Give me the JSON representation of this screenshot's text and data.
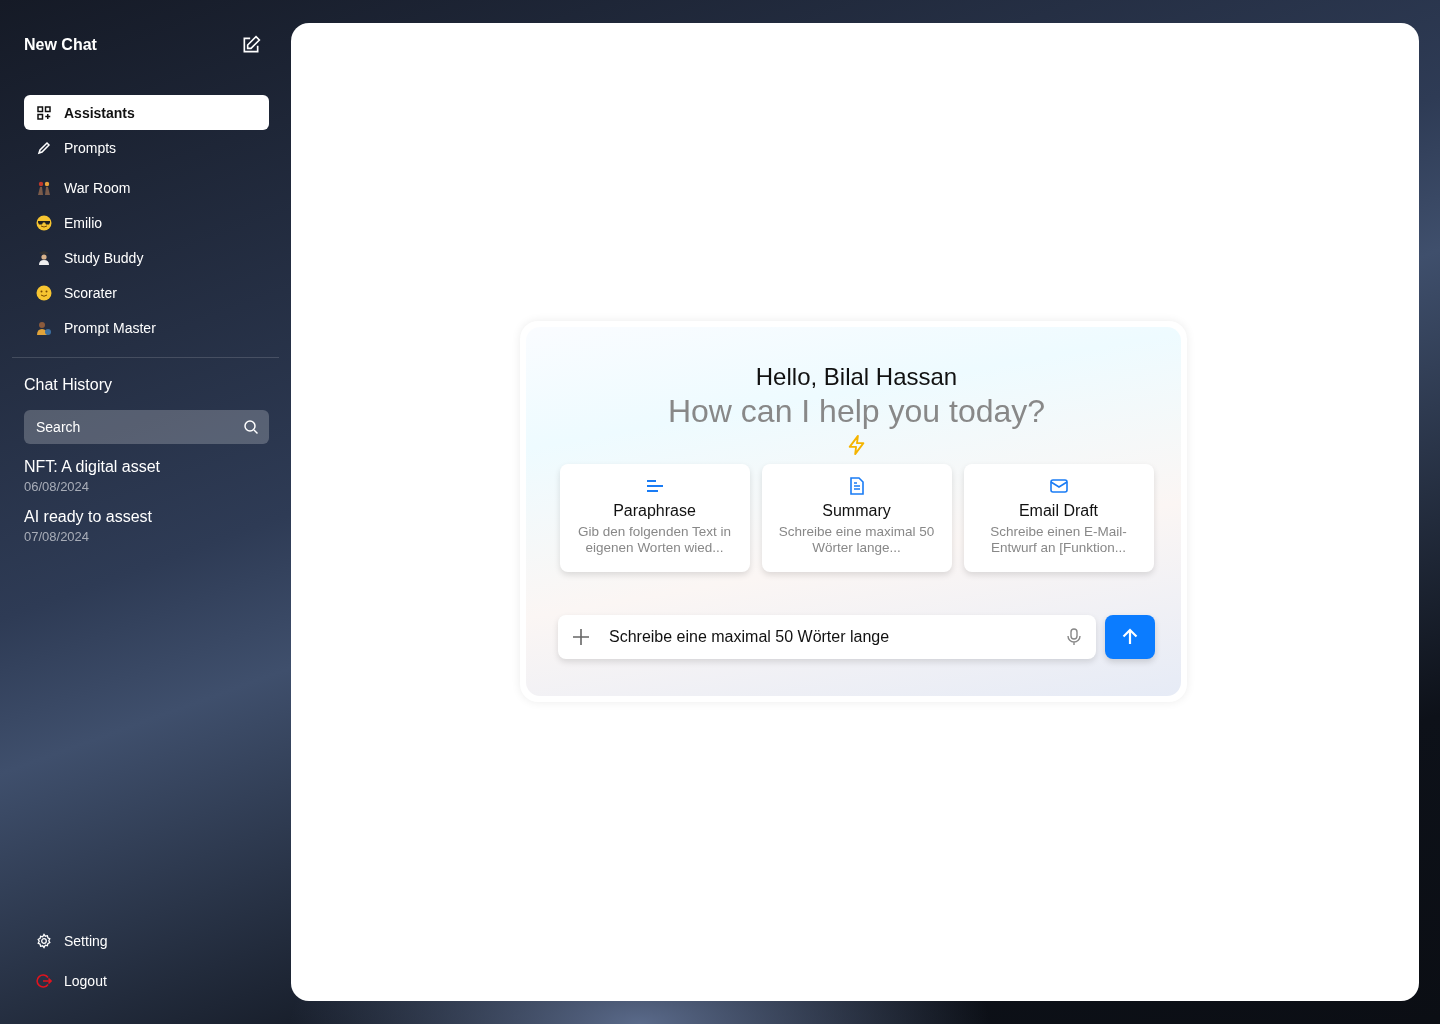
{
  "sidebar": {
    "new_chat": "New Chat",
    "nav": [
      {
        "label": "Assistants",
        "selected": true
      },
      {
        "label": "Prompts",
        "selected": false
      }
    ],
    "assistants": [
      {
        "name": "War Room"
      },
      {
        "name": "Emilio"
      },
      {
        "name": "Study Buddy"
      },
      {
        "name": "Scorater"
      },
      {
        "name": "Prompt Master"
      }
    ],
    "history_title": "Chat History",
    "search": {
      "placeholder": "Search"
    },
    "history": [
      {
        "title": "NFT: A digital asset",
        "date": "06/08/2024"
      },
      {
        "title": "AI ready to assest",
        "date": "07/08/2024"
      }
    ],
    "footer": [
      {
        "label": "Setting",
        "kind": "settings"
      },
      {
        "label": "Logout",
        "kind": "logout"
      }
    ]
  },
  "main": {
    "greeting": "Hello, Bilal Hassan",
    "question": "How can I help you today?",
    "suggestions": [
      {
        "title": "Paraphrase",
        "text": "Gib den folgenden Text in eigenen Worten wied...",
        "kind": "lines"
      },
      {
        "title": "Summary",
        "text": "Schreibe eine maximal 50 Wörter lange...",
        "kind": "document"
      },
      {
        "title": "Email Draft",
        "text": "Schreibe einen E-Mail-Entwurf an [Funktion...",
        "kind": "mail"
      }
    ],
    "input": {
      "value": "Schreibe eine maximal 50 Wörter lange"
    }
  }
}
